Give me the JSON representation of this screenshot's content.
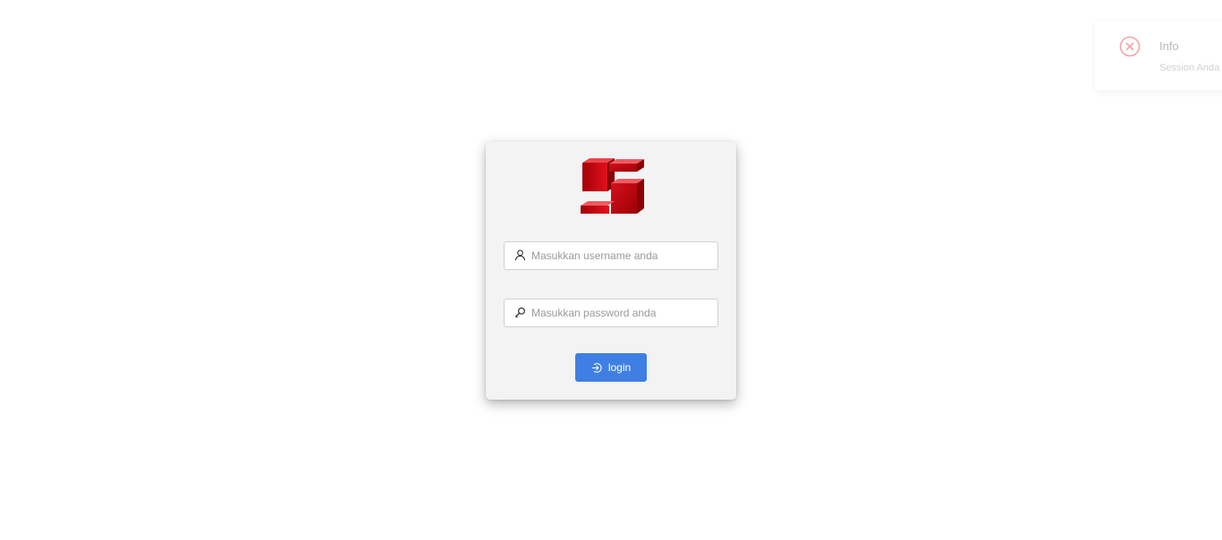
{
  "login": {
    "logo": "brand-logo",
    "username": {
      "icon": "user-icon",
      "placeholder": "Masukkan username anda",
      "value": ""
    },
    "password": {
      "icon": "key-icon",
      "placeholder": "Masukkan password anda",
      "value": ""
    },
    "button": {
      "icon": "login-icon",
      "label": "login",
      "color": "#3f7fe3"
    }
  },
  "toast": {
    "icon": "close-circle-icon",
    "title": "Info",
    "message": "Session Anda",
    "icon_color": "#f4a3aa"
  },
  "colors": {
    "logo_red": "#c8000a",
    "card_bg": "#f3f3f3"
  }
}
